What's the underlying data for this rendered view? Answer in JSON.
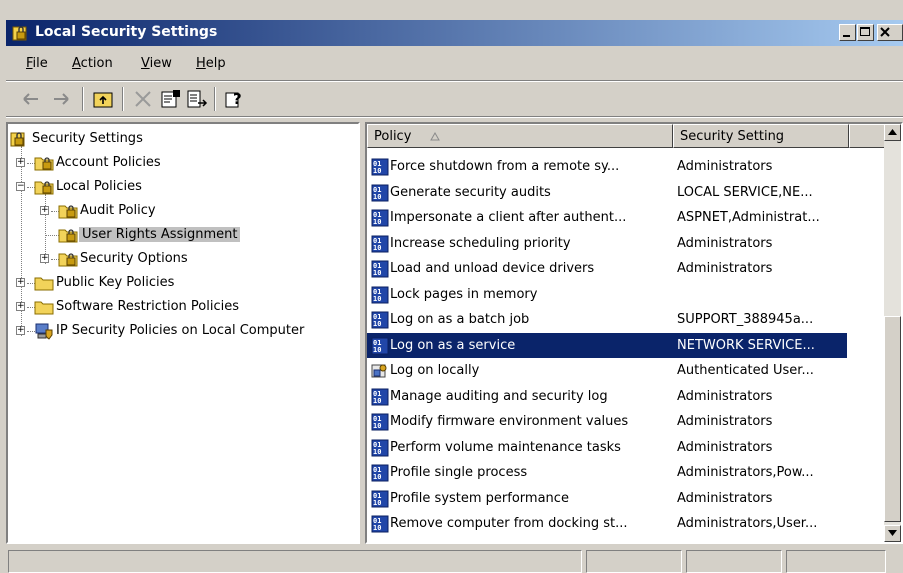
{
  "window": {
    "title": "Local Security Settings",
    "colors": {
      "titlebar_start": "#0a246a",
      "titlebar_end": "#a6caf0",
      "selection": "#0a246a",
      "face": "#d4d0c8"
    }
  },
  "menu": {
    "file": {
      "underlined": "F",
      "rest": "ile"
    },
    "action": {
      "underlined": "A",
      "rest": "ction"
    },
    "view": {
      "underlined": "V",
      "rest": "iew"
    },
    "help": {
      "underlined": "H",
      "rest": "elp"
    }
  },
  "toolbar": {
    "icons": [
      "back-arrow-icon",
      "forward-arrow-icon",
      "up-one-level-icon",
      "delete-icon",
      "properties-icon",
      "export-list-icon",
      "help-icon"
    ]
  },
  "tree": {
    "root": "Security Settings",
    "account_policies": "Account Policies",
    "local_policies": "Local Policies",
    "audit_policy": "Audit Policy",
    "user_rights_assignment": "User Rights Assignment",
    "security_options": "Security Options",
    "public_key_policies": "Public Key Policies",
    "software_restriction_policies": "Software Restriction Policies",
    "ip_security_policies": "IP Security Policies on Local Computer",
    "selected": "User Rights Assignment"
  },
  "list": {
    "columns": {
      "policy": "Policy",
      "setting": "Security Setting"
    },
    "sort_column": "Policy",
    "rows": [
      {
        "policy": "Force shutdown from a remote sy...",
        "setting": "Administrators",
        "icon": "policy-icon"
      },
      {
        "policy": "Generate security audits",
        "setting": "LOCAL SERVICE,NE...",
        "icon": "policy-icon"
      },
      {
        "policy": "Impersonate a client after authent...",
        "setting": "ASPNET,Administrat...",
        "icon": "policy-icon"
      },
      {
        "policy": "Increase scheduling priority",
        "setting": "Administrators",
        "icon": "policy-icon"
      },
      {
        "policy": "Load and unload device drivers",
        "setting": "Administrators",
        "icon": "policy-icon"
      },
      {
        "policy": "Lock pages in memory",
        "setting": "",
        "icon": "policy-icon"
      },
      {
        "policy": "Log on as a batch job",
        "setting": "SUPPORT_388945a...",
        "icon": "policy-icon"
      },
      {
        "policy": "Log on as a service",
        "setting": "NETWORK SERVICE...",
        "icon": "policy-icon",
        "selected": true
      },
      {
        "policy": "Log on locally",
        "setting": "Authenticated User...",
        "icon": "policy-user-icon"
      },
      {
        "policy": "Manage auditing and security log",
        "setting": "Administrators",
        "icon": "policy-icon"
      },
      {
        "policy": "Modify firmware environment values",
        "setting": "Administrators",
        "icon": "policy-icon"
      },
      {
        "policy": "Perform volume maintenance tasks",
        "setting": "Administrators",
        "icon": "policy-icon"
      },
      {
        "policy": "Profile single process",
        "setting": "Administrators,Pow...",
        "icon": "policy-icon"
      },
      {
        "policy": "Profile system performance",
        "setting": "Administrators",
        "icon": "policy-icon"
      },
      {
        "policy": "Remove computer from docking st...",
        "setting": "Administrators,User...",
        "icon": "policy-icon"
      }
    ]
  }
}
